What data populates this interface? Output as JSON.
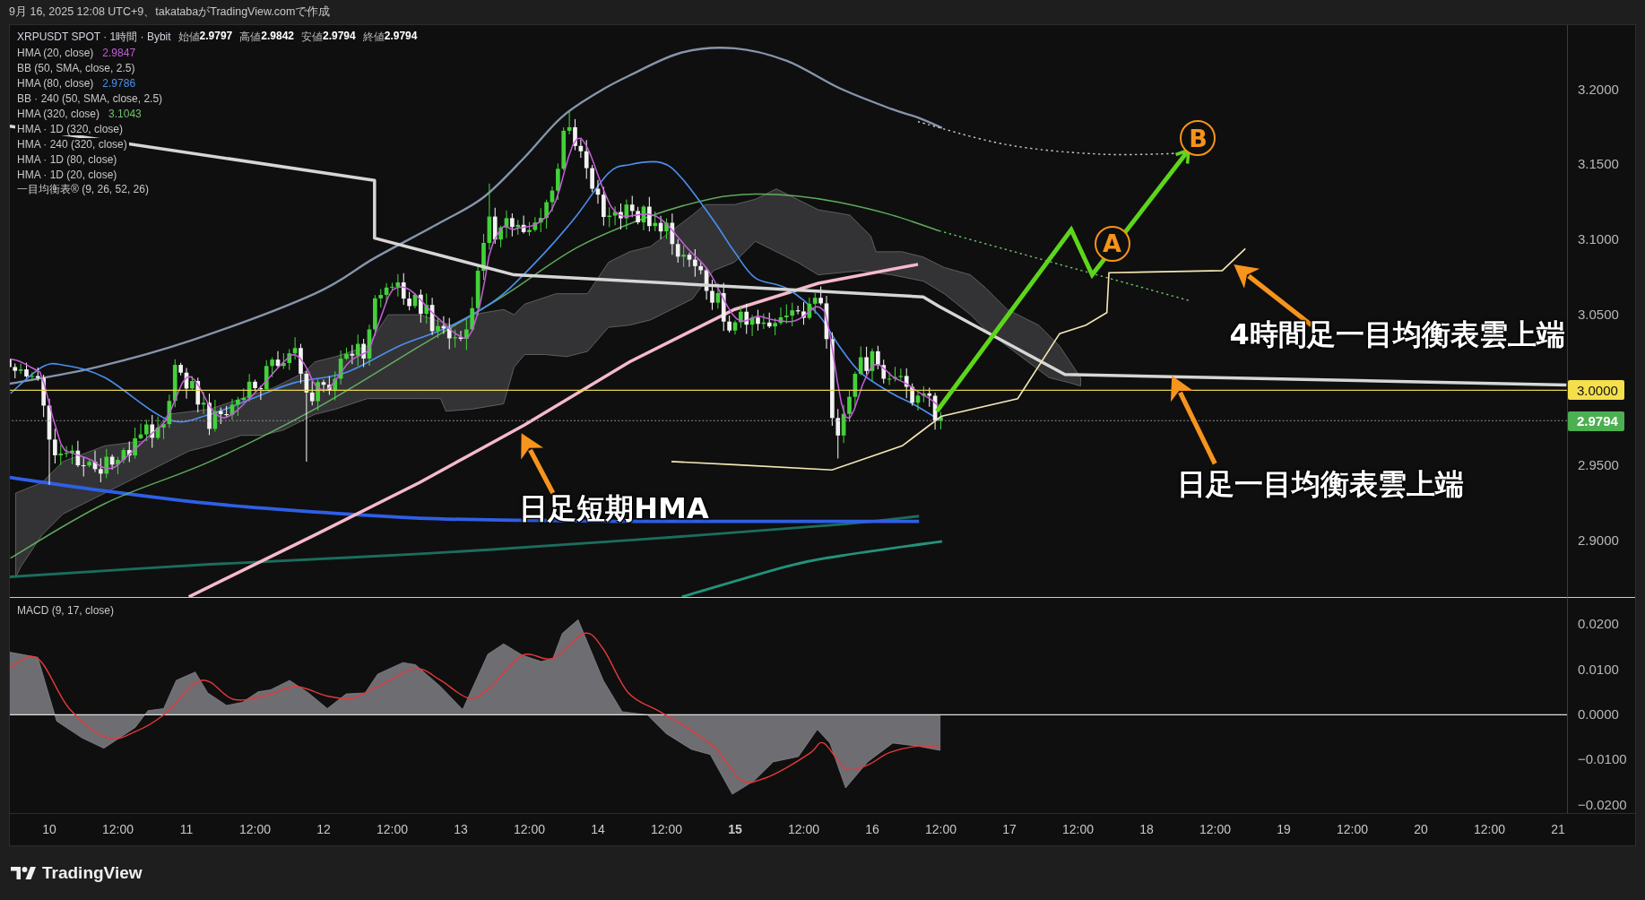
{
  "header": {
    "text": "9月 16, 2025 12:08 UTC+9、takatabaがTradingView.comで作成"
  },
  "legend": {
    "symbol": "XRPUSDT SPOT · 1時間 · Bybit",
    "ohlc": [
      {
        "label": "始値",
        "value": "2.9797"
      },
      {
        "label": "高値",
        "value": "2.9842"
      },
      {
        "label": "安値",
        "value": "2.9794"
      },
      {
        "label": "終値",
        "value": "2.9794"
      }
    ],
    "indicators": [
      {
        "name": "HMA (20, close)",
        "value": "2.9847",
        "color": "#c45fd6"
      },
      {
        "name": "BB (50, SMA, close, 2.5)"
      },
      {
        "name": "HMA (80, close)",
        "value": "2.9786",
        "color": "#4a8ff0"
      },
      {
        "name": "BB · 240 (50, SMA, close, 2.5)"
      },
      {
        "name": "HMA (320, close)",
        "value": "3.1043",
        "color": "#6cc46a"
      },
      {
        "name": "HMA · 1D (320, close)"
      },
      {
        "name": "HMA · 240 (320, close)"
      },
      {
        "name": "HMA · 1D (80, close)"
      },
      {
        "name": "HMA · 1D (20, close)"
      },
      {
        "name": "一目均衡表® (9, 26, 52, 26)"
      }
    ]
  },
  "annotations": [
    {
      "text": "日足短期HMA"
    },
    {
      "text": "4時間足一目均衡表雲上端"
    },
    {
      "text": "日足一目均衡表雲上端"
    }
  ],
  "wave_points": [
    {
      "text": "A"
    },
    {
      "text": "B"
    }
  ],
  "price_axis": {
    "ticks": [
      "3.2000",
      "3.1500",
      "3.1000",
      "3.0500",
      "2.9500",
      "2.9000"
    ],
    "markers": [
      {
        "kind": "level",
        "text": "3.0000"
      },
      {
        "kind": "last_price",
        "text": "2.9794"
      }
    ]
  },
  "macd": {
    "title": "MACD (9, 17, close)",
    "axis": [
      "0.0200",
      "0.0100",
      "0.0000",
      "−0.0100",
      "−0.0200"
    ]
  },
  "time_axis": [
    {
      "text": "10",
      "emphasized": false
    },
    {
      "text": "12:00",
      "emphasized": false
    },
    {
      "text": "11",
      "emphasized": false
    },
    {
      "text": "12:00",
      "emphasized": false
    },
    {
      "text": "12",
      "emphasized": false
    },
    {
      "text": "12:00",
      "emphasized": false
    },
    {
      "text": "13",
      "emphasized": false
    },
    {
      "text": "12:00",
      "emphasized": false
    },
    {
      "text": "14",
      "emphasized": false
    },
    {
      "text": "12:00",
      "emphasized": false
    },
    {
      "text": "15",
      "emphasized": true
    },
    {
      "text": "12:00",
      "emphasized": false
    },
    {
      "text": "16",
      "emphasized": false
    },
    {
      "text": "12:00",
      "emphasized": false
    },
    {
      "text": "17",
      "emphasized": false
    },
    {
      "text": "12:00",
      "emphasized": false
    },
    {
      "text": "18",
      "emphasized": false
    },
    {
      "text": "12:00",
      "emphasized": false
    },
    {
      "text": "19",
      "emphasized": false
    },
    {
      "text": "12:00",
      "emphasized": false
    },
    {
      "text": "20",
      "emphasized": false
    },
    {
      "text": "12:00",
      "emphasized": false
    },
    {
      "text": "21",
      "emphasized": false
    }
  ],
  "footer": {
    "brand": "TradingView"
  }
}
